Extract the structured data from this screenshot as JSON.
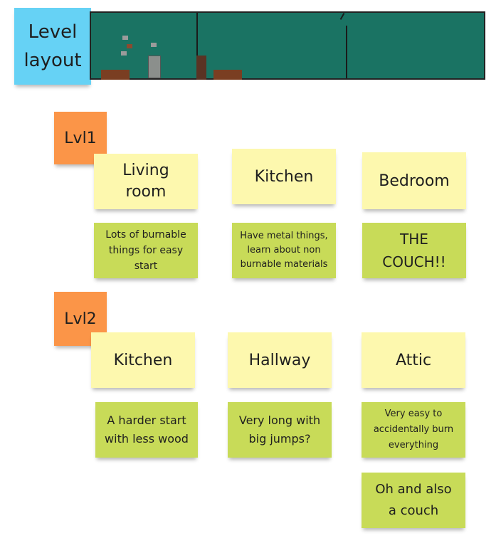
{
  "title_note": "Level\nlayout",
  "scene": {
    "name": "level-preview",
    "colors": {
      "wall": "#1a7363",
      "furniture": "#7a3e22",
      "outline": "#1b1b1b"
    }
  },
  "levels": [
    {
      "label": "Lvl1",
      "rooms": [
        {
          "name": "Living\nroom",
          "note": "Lots of burnable\nthings for easy\nstart"
        },
        {
          "name": "Kitchen",
          "note": "Have metal things,\nlearn about non\nburnable materials"
        },
        {
          "name": "Bedroom",
          "note": "THE\nCOUCH!!"
        }
      ]
    },
    {
      "label": "Lvl2",
      "rooms": [
        {
          "name": "Kitchen",
          "note": "A harder start\nwith less wood"
        },
        {
          "name": "Hallway",
          "note": "Very long with\nbig jumps?"
        },
        {
          "name": "Attic",
          "note": "Very easy to\naccidentally burn\neverything",
          "extra_note": "Oh and also\na couch"
        }
      ]
    }
  ],
  "colors": {
    "blue": "#66d2f5",
    "orange": "#fb9548",
    "yellow": "#fdf8ae",
    "green": "#c8db58"
  }
}
